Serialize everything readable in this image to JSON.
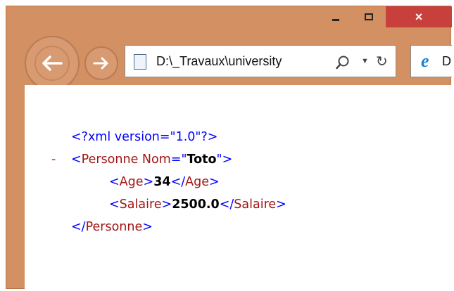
{
  "window": {
    "controls": {
      "minimize": "minimize",
      "maximize": "maximize",
      "close": "×"
    }
  },
  "toolbar": {
    "address": "D:\\_Travaux\\university",
    "tab_text": "D"
  },
  "xml": {
    "declaration": "<?xml version=\"1.0\"?>",
    "collapse_marker": "-",
    "open_bracket": "<",
    "close_bracket": ">",
    "end_open": "</",
    "eq_quote": "=\"",
    "quote_close": "\">",
    "root_tag": "Personne",
    "root_attr_name": "Nom",
    "root_attr_value": "Toto",
    "age_tag": "Age",
    "age_value": "34",
    "salary_tag": "Salaire",
    "salary_value": "2500.0"
  },
  "colors": {
    "frame": "#D39062",
    "close": "#C7403C",
    "markup_blue": "#0000FF",
    "tag_red": "#A31515",
    "marker_red": "#D01020"
  },
  "icons": [
    "minimize-icon",
    "maximize-icon",
    "close-icon",
    "back-arrow-icon",
    "forward-arrow-icon",
    "page-icon",
    "search-icon",
    "dropdown-icon",
    "refresh-icon",
    "ie-logo-icon"
  ]
}
